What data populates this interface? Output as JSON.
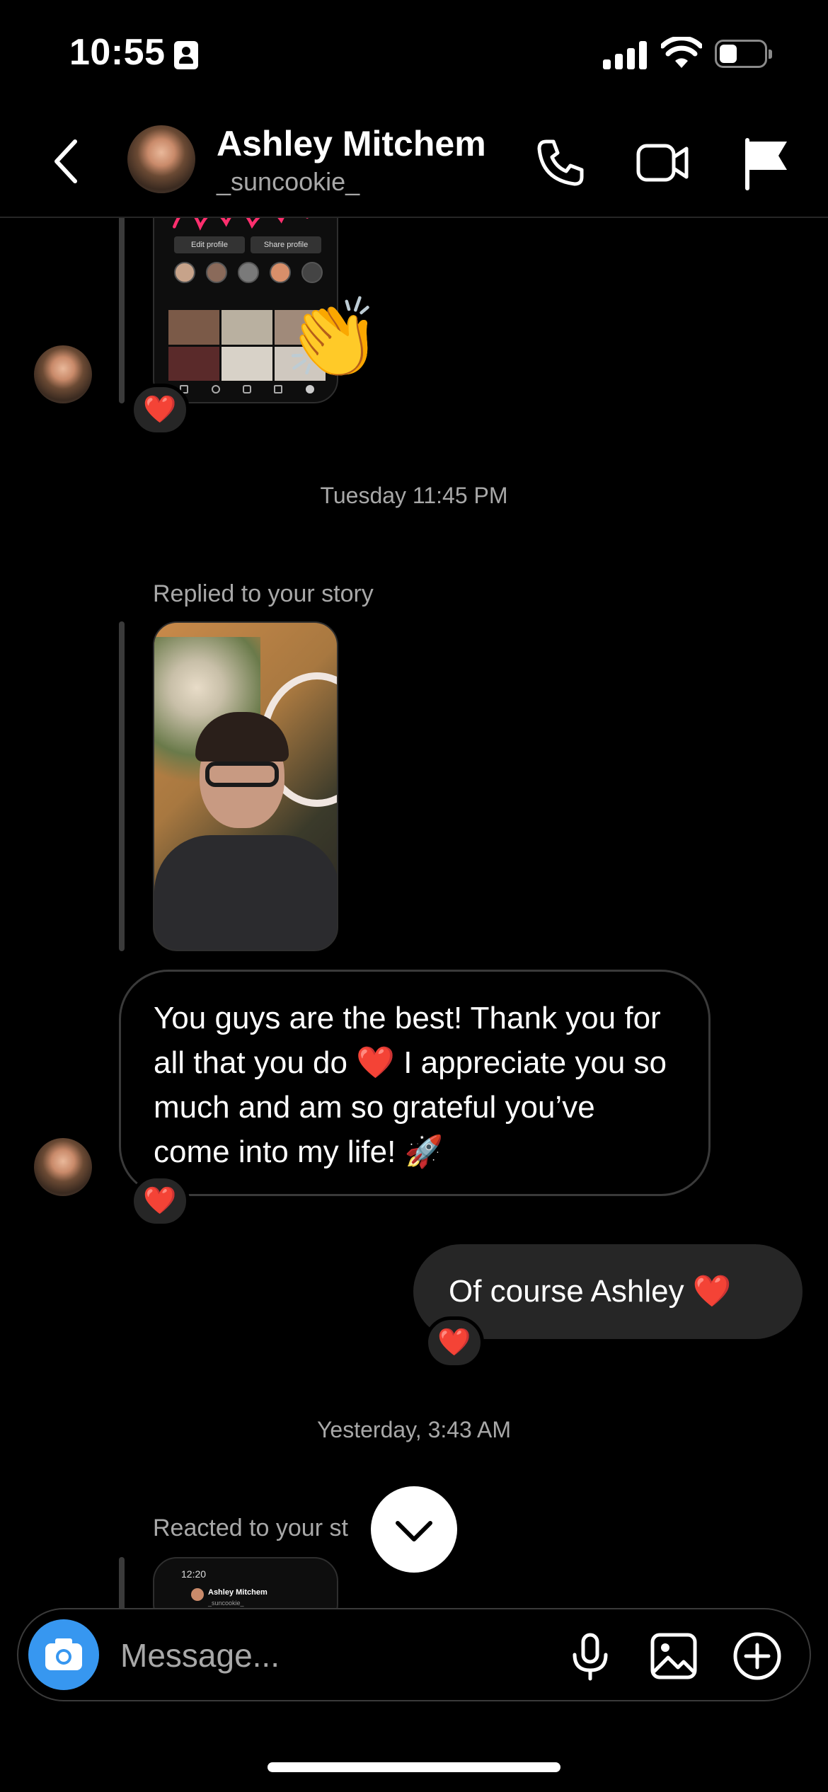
{
  "status_bar": {
    "time": "10:55"
  },
  "header": {
    "name": "Ashley Mitchem",
    "username": "_suncookie_",
    "icons": [
      "chevron-left-icon",
      "phone-icon",
      "video-icon",
      "flag-icon"
    ]
  },
  "messages": {
    "reaction_emoji": "❤️",
    "clap_emoji": "👏",
    "timestamp_1": "Tuesday 11:45 PM",
    "reply_label": "Replied to your story",
    "incoming_text": "You guys are the best! Thank you for all that you do ❤️ I appreciate you so much and am so grateful you’ve come into my life! 🚀",
    "outgoing_text": "Of course Ashley ❤️",
    "timestamp_2": "Yesterday, 3:43 AM",
    "reacted_label": "Reacted to your st",
    "mini_time": "12:20",
    "mini_name": "Ashley Mitchem",
    "mini_username": "_suncookie_",
    "mini_profile": {
      "edit": "Edit profile",
      "share": "Share profile"
    }
  },
  "composer": {
    "placeholder": "Message..."
  },
  "colors": {
    "accent": "#3797f0",
    "bubble_out": "#262626",
    "muted": "#a8a8a8"
  }
}
